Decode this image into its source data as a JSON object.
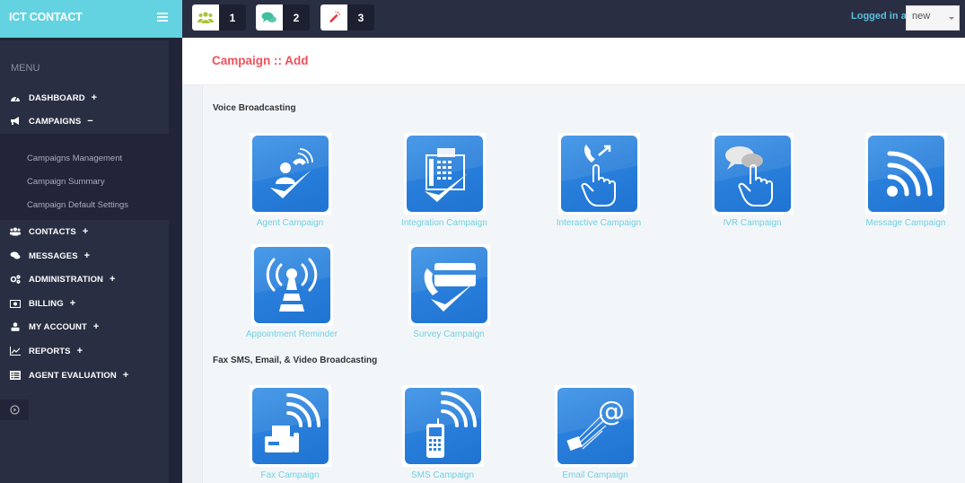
{
  "app": {
    "title": "ICT CONTACT"
  },
  "topbar": {
    "notifications": [
      {
        "icon": "users-icon",
        "count": "1",
        "color": "#a6c435"
      },
      {
        "icon": "chat-icon",
        "count": "2",
        "color": "#3fbf9e"
      },
      {
        "icon": "magic-wand-icon",
        "count": "3",
        "color": "#e8323c"
      }
    ],
    "logged_in_label": "Logged in as :",
    "user_select_value": "new"
  },
  "sidebar": {
    "menu_label": "MENU",
    "items": [
      {
        "label": "DASHBOARD",
        "icon": "dashboard-icon",
        "toggle": "+"
      },
      {
        "label": "CAMPAIGNS",
        "icon": "bullhorn-icon",
        "toggle": "−"
      },
      {
        "label": "CONTACTS",
        "icon": "users-icon",
        "toggle": "+"
      },
      {
        "label": "MESSAGES",
        "icon": "comments-icon",
        "toggle": "+"
      },
      {
        "label": "ADMINISTRATION",
        "icon": "cogs-icon",
        "toggle": "+"
      },
      {
        "label": "BILLING",
        "icon": "money-icon",
        "toggle": "+"
      },
      {
        "label": "MY ACCOUNT",
        "icon": "user-icon",
        "toggle": "+"
      },
      {
        "label": "REPORTS",
        "icon": "line-chart-icon",
        "toggle": "+"
      },
      {
        "label": "AGENT EVALUATION",
        "icon": "list-alt-icon",
        "toggle": "+"
      }
    ],
    "campaign_submenu": [
      "Campaigns Management",
      "Campaign Summary",
      "Campaign Default Settings"
    ]
  },
  "page": {
    "title": "Campaign :: Add",
    "sections": [
      {
        "title": "Voice Broadcasting",
        "tiles": [
          {
            "label": "Agent Campaign",
            "icon": "agent-campaign-icon"
          },
          {
            "label": "Integration Campaign",
            "icon": "integration-campaign-icon"
          },
          {
            "label": "Interactive Campaign",
            "icon": "interactive-campaign-icon"
          },
          {
            "label": "IVR Campaign",
            "icon": "ivr-campaign-icon"
          },
          {
            "label": "Message Campaign",
            "icon": "message-campaign-icon"
          },
          {
            "label": "Appointment Reminder",
            "icon": "appointment-reminder-icon"
          },
          {
            "label": "Survey Campaign",
            "icon": "survey-campaign-icon"
          }
        ]
      },
      {
        "title": "Fax SMS, Email, & Video Broadcasting",
        "tiles": [
          {
            "label": "Fax Campaign",
            "icon": "fax-campaign-icon"
          },
          {
            "label": "SMS Campaign",
            "icon": "sms-campaign-icon"
          },
          {
            "label": "Email Campaign",
            "icon": "email-campaign-icon"
          }
        ]
      }
    ]
  }
}
